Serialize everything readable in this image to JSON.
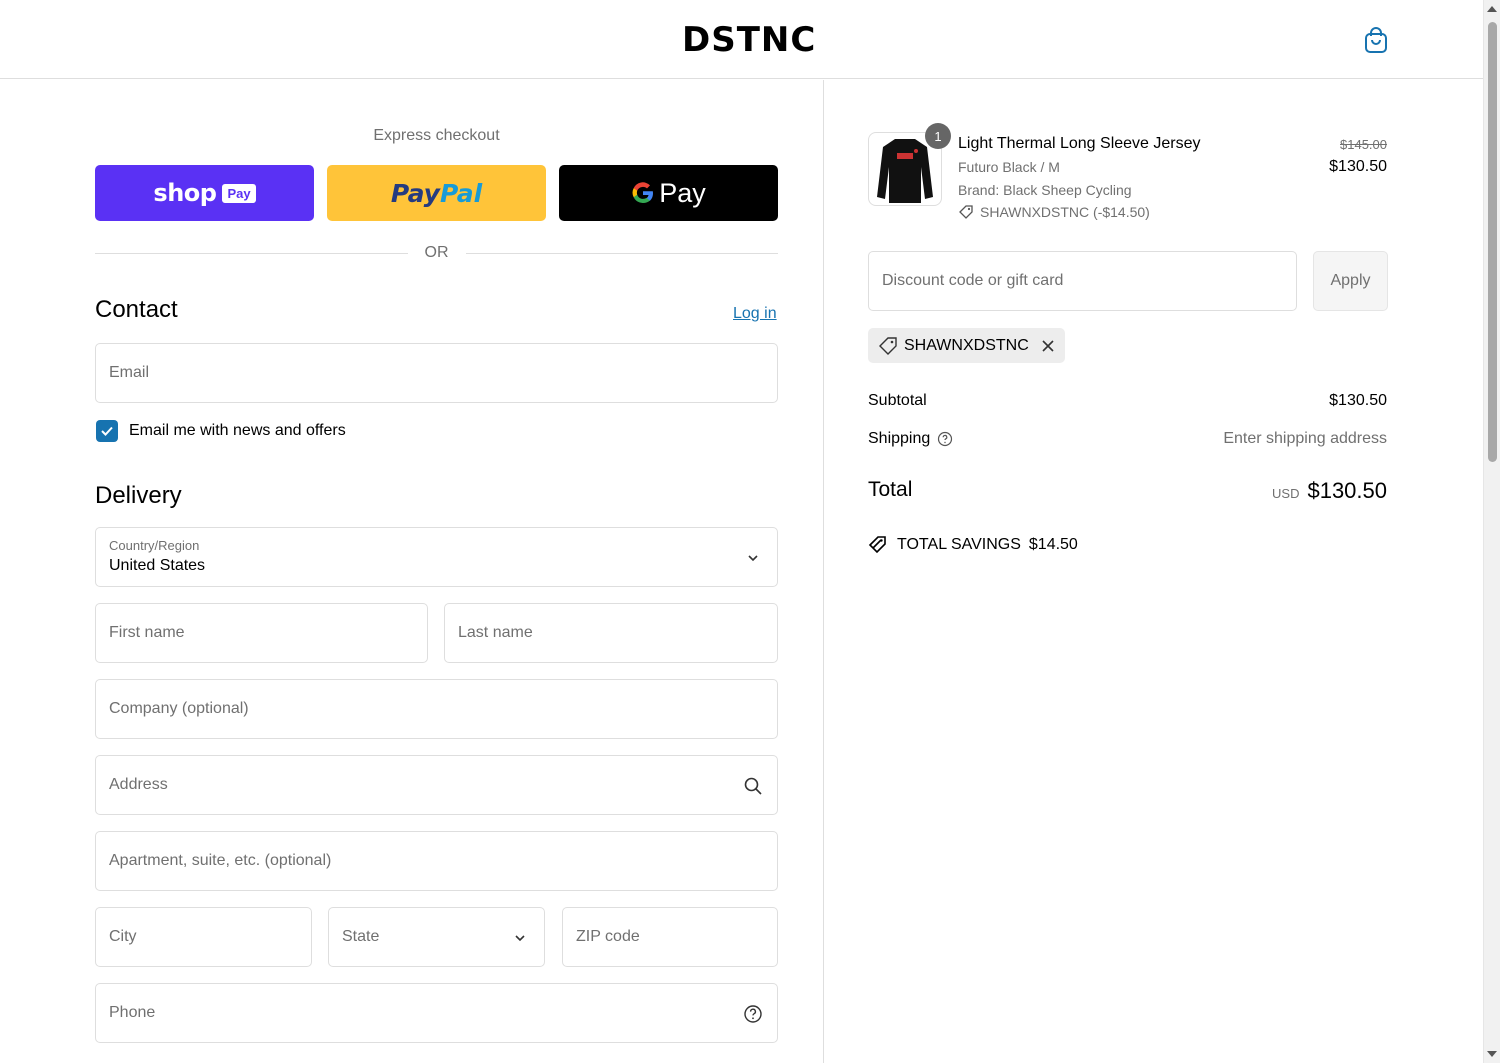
{
  "header": {
    "logo": "DSTNC",
    "cart_icon": "shopping-bag-icon"
  },
  "express": {
    "title": "Express checkout",
    "shop_pay": {
      "word": "shop",
      "badge": "Pay"
    },
    "paypal": {
      "part_a": "Pay",
      "part_b": "Pal"
    },
    "gpay": {
      "g": "G",
      "text": "Pay"
    },
    "or": "OR"
  },
  "contact": {
    "title": "Contact",
    "login": "Log in",
    "email_placeholder": "Email",
    "newsletter_label": "Email me with news and offers",
    "newsletter_checked": true
  },
  "delivery": {
    "title": "Delivery",
    "country_label": "Country/Region",
    "country_value": "United States",
    "first_name": "First name",
    "last_name": "Last name",
    "company": "Company (optional)",
    "address": "Address",
    "apartment": "Apartment, suite, etc. (optional)",
    "city": "City",
    "state": "State",
    "zip": "ZIP code",
    "phone": "Phone"
  },
  "summary": {
    "product": {
      "quantity": "1",
      "name": "Light Thermal Long Sleeve Jersey",
      "variant": "Futuro Black / M",
      "brand": "Brand: Black Sheep Cycling",
      "discount": "SHAWNXDSTNC (-$14.50)",
      "price_old": "$145.00",
      "price_new": "$130.50"
    },
    "discount_placeholder": "Discount code or gift card",
    "apply": "Apply",
    "applied_code": "SHAWNXDSTNC",
    "subtotal_label": "Subtotal",
    "subtotal_value": "$130.50",
    "shipping_label": "Shipping",
    "shipping_value": "Enter shipping address",
    "total_label": "Total",
    "total_currency": "USD",
    "total_value": "$130.50",
    "savings_label": "TOTAL SAVINGS",
    "savings_value": "$14.50"
  },
  "colors": {
    "accent": "#1773b0",
    "shop_pay": "#5a31f4",
    "paypal": "#ffc439"
  }
}
